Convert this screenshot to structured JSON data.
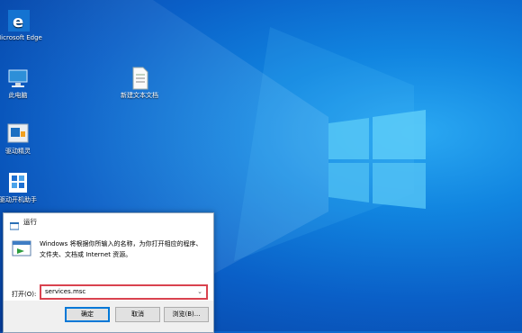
{
  "desktop": {
    "icons": [
      {
        "label": "Microsoft Edge",
        "icon": "edge-icon"
      },
      {
        "label": "此电脑",
        "icon": "computer-icon"
      },
      {
        "label": "新建文本文档",
        "icon": "text-file-icon"
      },
      {
        "label": "驱动精灵",
        "icon": "driver-tool-icon"
      },
      {
        "label": "驱动开机助手",
        "icon": "puzzle-icon"
      }
    ]
  },
  "run_dialog": {
    "title": "运行",
    "description": "Windows 将根据你所输入的名称，为你打开相应的程序、文件夹、文档或 Internet 资源。",
    "open_label": "打开(O):",
    "open_value": "services.msc",
    "buttons": {
      "ok": "确定",
      "cancel": "取消",
      "browse": "浏览(B)..."
    }
  },
  "colors": {
    "highlight_border": "#d9434f",
    "accent": "#0078d7"
  }
}
